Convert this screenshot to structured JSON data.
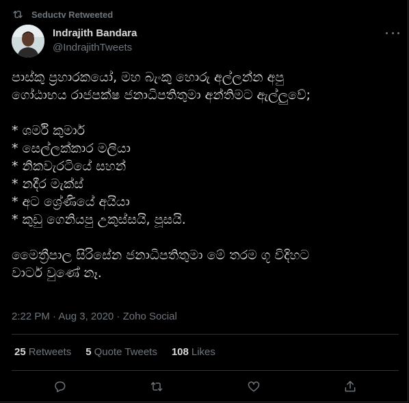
{
  "retweet_context": {
    "label": "Seductv Retweeted",
    "icon": "retweet-icon"
  },
  "author": {
    "name": "Indrajith Bandara",
    "handle": "@IndrajithTweets"
  },
  "tweet": {
    "text": "පාස්කු ප්‍රහාරකයෝ, මහ බැංකු හොරු අල්ලන්න අපු\nගෝඨාභය රාජපක්ෂ ජනාධිපතිතුමා අන්තිමට ඇල්ලුවේ;\n\n* ශර්මි කුමාර්\n* සෙල්ලක්කාර මලියා\n* නිකවැරටියේ සහන්\n* නදීර මැක්ස්\n* අට ශ්‍රේණියේ අයියා\n* කුඩු ගෙනියපු උකුස්සයි, පූසයි.\n\nමෛත්‍රීපාල සිරිසේන ජනාධිපතිතුමා මේ තරම ගූ විදිහට\nවාටර් වුණේ නෑ.",
    "timestamp": "2:22 PM · Aug 3, 2020 · Zoho Social"
  },
  "stats": {
    "retweets": {
      "count": "25",
      "label": "Retweets"
    },
    "quotes": {
      "count": "5",
      "label": "Quote Tweets"
    },
    "likes": {
      "count": "108",
      "label": "Likes"
    }
  },
  "actions": [
    "reply-icon",
    "retweet-icon",
    "like-icon",
    "share-icon"
  ],
  "colors": {
    "background": "#000000",
    "text": "#d9d9d9",
    "muted": "#6e767d",
    "divider": "#2f3336"
  }
}
